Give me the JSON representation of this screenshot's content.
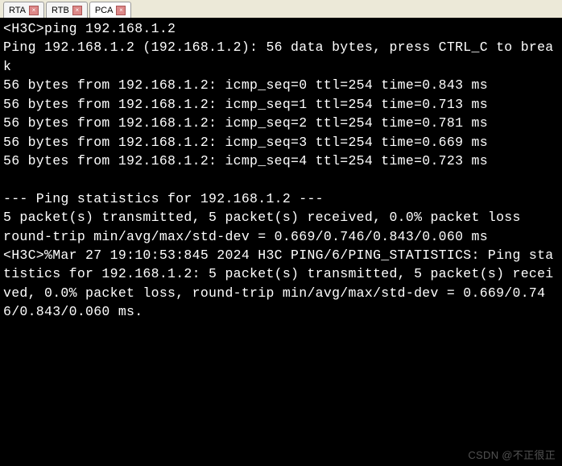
{
  "tabs": [
    {
      "label": "RTA",
      "active": false
    },
    {
      "label": "RTB",
      "active": false
    },
    {
      "label": "PCA",
      "active": true
    }
  ],
  "terminal": {
    "lines": [
      "<H3C>ping 192.168.1.2",
      "Ping 192.168.1.2 (192.168.1.2): 56 data bytes, press CTRL_C to break",
      "56 bytes from 192.168.1.2: icmp_seq=0 ttl=254 time=0.843 ms",
      "56 bytes from 192.168.1.2: icmp_seq=1 ttl=254 time=0.713 ms",
      "56 bytes from 192.168.1.2: icmp_seq=2 ttl=254 time=0.781 ms",
      "56 bytes from 192.168.1.2: icmp_seq=3 ttl=254 time=0.669 ms",
      "56 bytes from 192.168.1.2: icmp_seq=4 ttl=254 time=0.723 ms",
      "",
      "--- Ping statistics for 192.168.1.2 ---",
      "5 packet(s) transmitted, 5 packet(s) received, 0.0% packet loss",
      "round-trip min/avg/max/std-dev = 0.669/0.746/0.843/0.060 ms",
      "<H3C>%Mar 27 19:10:53:845 2024 H3C PING/6/PING_STATISTICS: Ping statistics for 192.168.1.2: 5 packet(s) transmitted, 5 packet(s) received, 0.0% packet loss, round-trip min/avg/max/std-dev = 0.669/0.746/0.843/0.060 ms."
    ]
  },
  "watermark": "CSDN @不正很正"
}
